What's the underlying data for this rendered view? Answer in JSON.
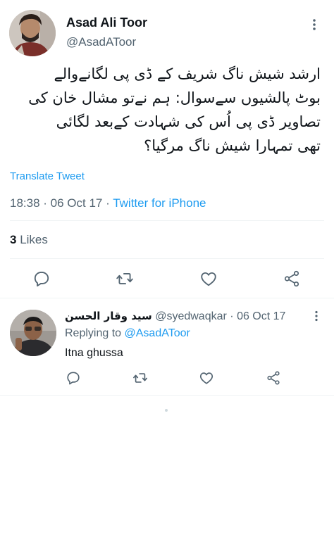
{
  "tweet": {
    "author_name": "Asad Ali Toor",
    "author_handle": "@AsadAToor",
    "text_lines": [
      "ارشد شیش ناگ شریف کے ڈی پی لگانےوالے",
      "بوٹ پالشیوں سےسوال: ہم نےتو مشال خان کی",
      "تصاویر ڈی پی اُس کی شہادت کےبعد لگائی",
      "تھی تمہارا شیش ناگ مرگیا؟"
    ],
    "translate_label": "Translate Tweet",
    "time": "18:38",
    "date": "06 Oct 17",
    "source": "Twitter for iPhone",
    "likes_count": "3",
    "likes_label": "Likes"
  },
  "reply": {
    "author_name": "سید وقار الحسن",
    "author_handle": "@syedwaqkar",
    "date": "06 Oct 17",
    "replying_prefix": "Replying to",
    "replying_to": "@AsadAToor",
    "text": "Itna ghussa"
  },
  "colors": {
    "accent": "#1d9bf0",
    "secondary_text": "#536471",
    "divider": "#eff3f4"
  },
  "icons": [
    "reply-icon",
    "retweet-icon",
    "like-icon",
    "share-icon",
    "more-icon"
  ]
}
